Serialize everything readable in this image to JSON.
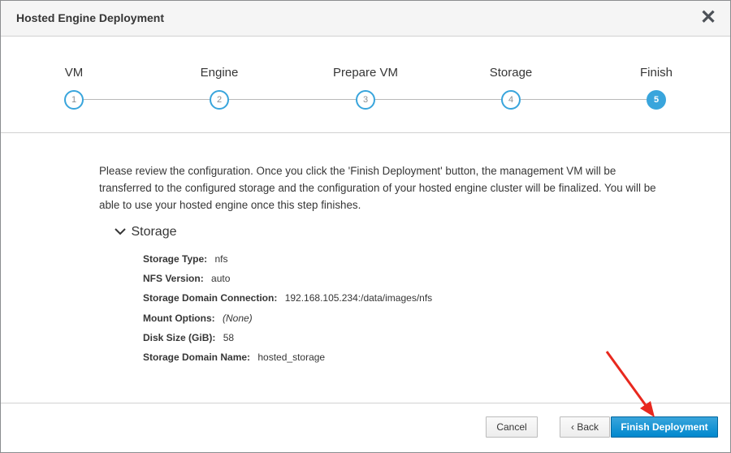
{
  "dialog": {
    "title": "Hosted Engine Deployment",
    "close_symbol": "✕"
  },
  "wizard": {
    "steps": [
      {
        "label": "VM",
        "number": "1"
      },
      {
        "label": "Engine",
        "number": "2"
      },
      {
        "label": "Prepare VM",
        "number": "3"
      },
      {
        "label": "Storage",
        "number": "4"
      },
      {
        "label": "Finish",
        "number": "5"
      }
    ],
    "active_step": 5
  },
  "review": {
    "intro_text": "Please review the configuration. Once you click the 'Finish Deployment' button, the management VM will be transferred to the configured storage and the configuration of your hosted engine cluster will be finalized. You will be able to use your hosted engine once this step finishes.",
    "section_title": "Storage",
    "fields": [
      {
        "label": "Storage Type:",
        "value": "nfs"
      },
      {
        "label": "NFS Version:",
        "value": "auto"
      },
      {
        "label": "Storage Domain Connection:",
        "value": "192.168.105.234:/data/images/nfs"
      },
      {
        "label": "Mount Options:",
        "value": "(None)"
      },
      {
        "label": "Disk Size (GiB):",
        "value": "58"
      },
      {
        "label": "Storage Domain Name:",
        "value": "hosted_storage"
      }
    ]
  },
  "footer": {
    "cancel_label": "Cancel",
    "back_label": "‹ Back",
    "finish_label": "Finish Deployment"
  },
  "colors": {
    "accent": "#39a5dc",
    "annotation_arrow": "#e8281e"
  }
}
